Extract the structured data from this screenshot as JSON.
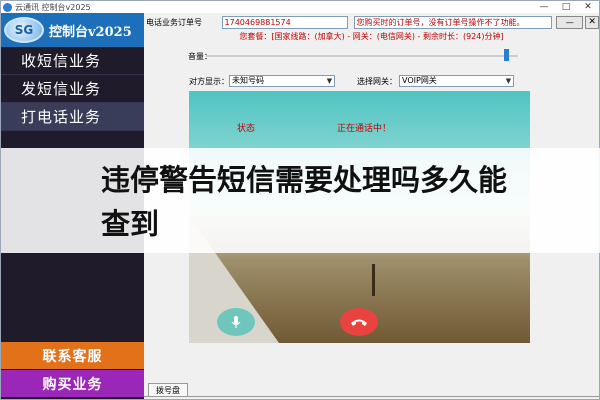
{
  "window": {
    "title": "云通讯 控制台v2025",
    "minimize": "—",
    "maximize": "□",
    "close": "✕"
  },
  "brand": {
    "logo": "SG",
    "text": "控制台v2025"
  },
  "nav": {
    "items": [
      {
        "label": "收短信业务"
      },
      {
        "label": "发短信业务"
      },
      {
        "label": "打电话业务"
      }
    ],
    "service": "联系客服",
    "buy": "购买业务"
  },
  "topbar": {
    "order_label": "电话业务订单号",
    "order_value": "1740469881574",
    "notice": "您购买时的订单号，没有订单号操作不了功能。",
    "minimize": "—",
    "close": "✕"
  },
  "package_line": "您套餐：[国家线路：(加拿大) - 网关：(电信网关) - 剩余时长：(924)分钟]",
  "volume": {
    "label": "音量：",
    "level": 0.97
  },
  "selectors": {
    "caller_label": "对方显示：",
    "caller_value": "未知号码",
    "gateway_label": "选择网关：",
    "gateway_value": "VOIP网关"
  },
  "call": {
    "status_label": "状态",
    "status_value": "正在通话中！"
  },
  "dialpad_tab": "拨号盘",
  "overlay": {
    "text": "违停警告短信需要处理吗多久能查到"
  },
  "colors": {
    "sidebar_bg": "#1f1b2a",
    "brand_bg": "#1c6fb8",
    "service_bg": "#e3711a",
    "buy_bg": "#9b27b8",
    "alert_red": "#c00000"
  }
}
